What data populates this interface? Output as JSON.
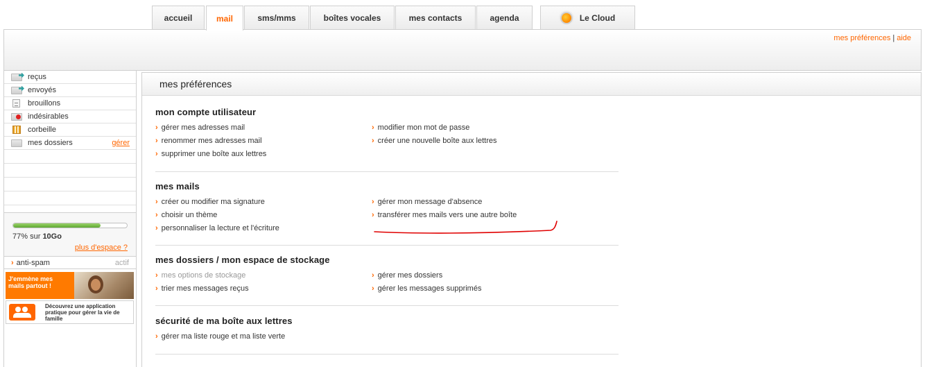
{
  "tabs": [
    {
      "label": "accueil",
      "active": false
    },
    {
      "label": "mail",
      "active": true
    },
    {
      "label": "sms/mms",
      "active": false
    },
    {
      "label": "boîtes vocales",
      "active": false
    },
    {
      "label": "mes contacts",
      "active": false
    },
    {
      "label": "agenda",
      "active": false
    }
  ],
  "cloud_tab": {
    "label": "Le Cloud",
    "icon": "cloud-globe-icon"
  },
  "header": {
    "preferences_link": "mes préférences",
    "separator": "|",
    "help_link": "aide"
  },
  "sidebar": {
    "folders": [
      {
        "label": "reçus",
        "icon": "inbox-icon"
      },
      {
        "label": "envoyés",
        "icon": "sent-icon"
      },
      {
        "label": "brouillons",
        "icon": "draft-icon"
      },
      {
        "label": "indésirables",
        "icon": "spam-icon"
      },
      {
        "label": "corbeille",
        "icon": "trash-icon"
      },
      {
        "label": "mes dossiers",
        "icon": "folder-icon",
        "action": "gérer"
      }
    ],
    "quota": {
      "percent": 77,
      "percent_text": "77%",
      "of_text": "sur",
      "total": "10Go",
      "more_link": "plus d'espace ?"
    },
    "antispam": {
      "label": "anti-spam",
      "state": "actif"
    },
    "promo1": {
      "text": "J'emmène mes mails partout !"
    },
    "promo2": {
      "text": "Découvrez une application pratique pour gérer la vie de famille"
    }
  },
  "main": {
    "title": "mes préférences",
    "sections": [
      {
        "title": "mon compte utilisateur",
        "left": [
          "gérer mes adresses mail",
          "renommer mes adresses mail",
          "supprimer une boîte aux lettres"
        ],
        "right": [
          "modifier mon mot de passe",
          "créer une nouvelle boîte aux lettres"
        ]
      },
      {
        "title": "mes mails",
        "left": [
          "créer ou modifier ma signature",
          "choisir un thème",
          "personnaliser la lecture et l'écriture"
        ],
        "right": [
          "gérer mon message d'absence",
          "transférer mes mails vers une autre boîte"
        ]
      },
      {
        "title": "mes dossiers / mon espace de stockage",
        "left": [
          "mes options de stockage",
          "trier mes messages reçus"
        ],
        "right": [
          "gérer mes dossiers",
          "gérer les messages supprimés"
        ]
      },
      {
        "title": "sécurité de ma boîte aux lettres",
        "left": [
          "gérer ma liste rouge et ma liste verte"
        ],
        "right": []
      }
    ]
  },
  "colors": {
    "accent": "#ff6600",
    "annotation": "#e00000",
    "quota_bar": "#5ea832"
  }
}
